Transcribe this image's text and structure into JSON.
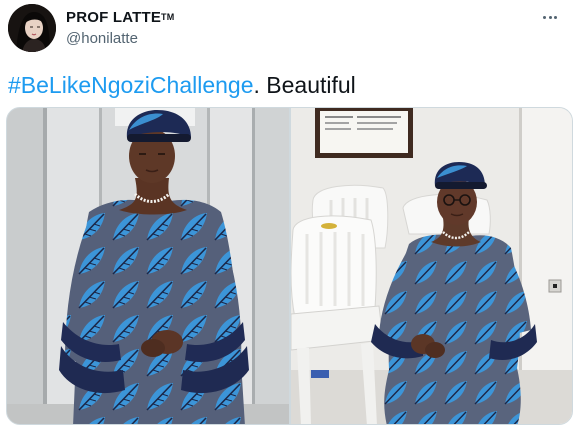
{
  "author": {
    "display_name": "PROF LATTE",
    "display_name_mark": "TM",
    "handle": "@honilatte",
    "avatar_icon": "profile-avatar"
  },
  "menu": {
    "more_icon": "ellipsis-icon"
  },
  "tweet": {
    "hashtag": "#BeLikeNgoziChallenge",
    "text": ". Beautiful"
  },
  "media": {
    "photos": [
      {
        "icon": "photo-woman-standing"
      },
      {
        "icon": "photo-woman-seated-white-chairs"
      }
    ]
  },
  "colors": {
    "link": "#1d9bf0",
    "secondary_text": "#536471",
    "border": "#cfd9de",
    "fabric_blue": "#3b8fd0",
    "fabric_navy": "#1f2a52"
  }
}
